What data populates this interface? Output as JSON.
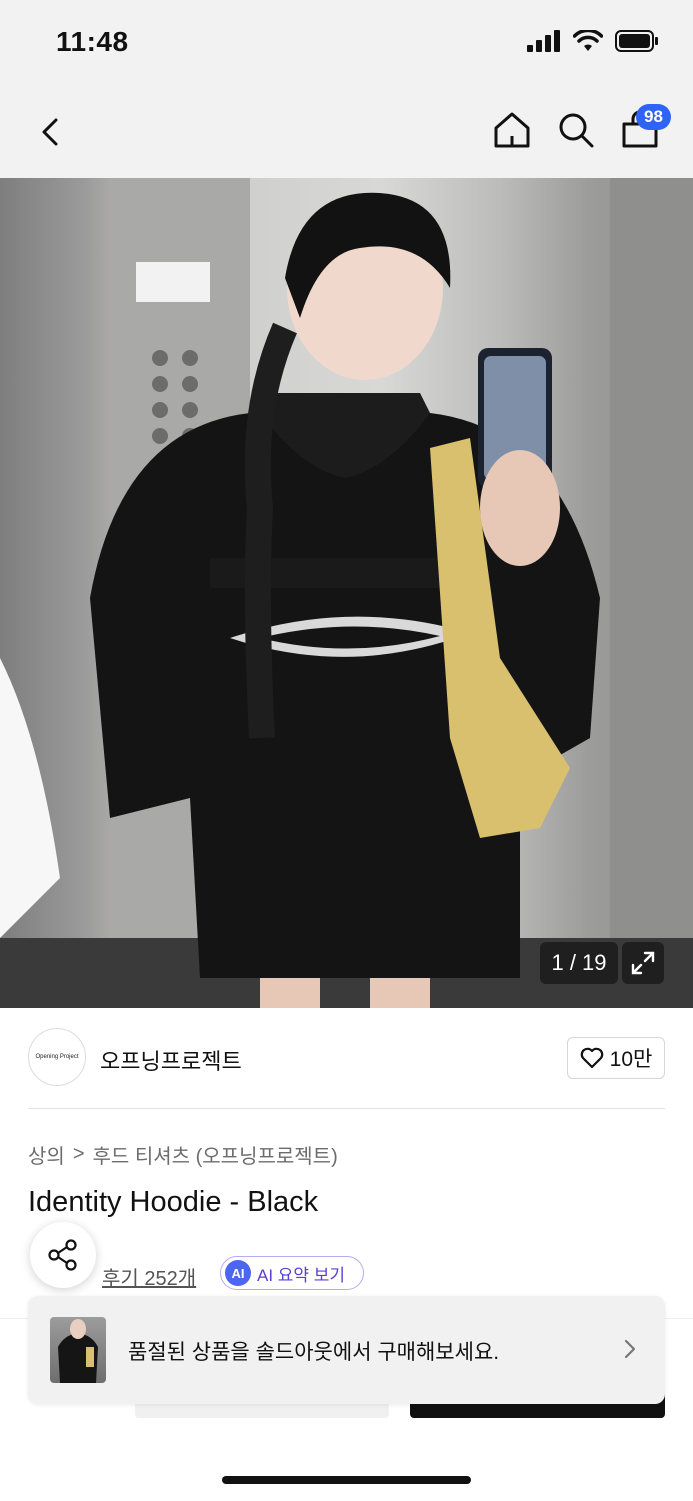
{
  "status_bar": {
    "time": "11:48"
  },
  "nav": {
    "cart_count": "98"
  },
  "gallery": {
    "counter": "1 / 19"
  },
  "brand": {
    "logo_text": "Opening Project",
    "name": "오프닝프로젝트",
    "likes": "10만"
  },
  "breadcrumb": {
    "category": "상의",
    "separator": ">",
    "subcategory": "후드 티셔츠 (오프닝프로젝트)"
  },
  "product": {
    "title": "Identity Hoodie - Black"
  },
  "reviews": {
    "label": "후기 252개",
    "ai_chip": "AI",
    "ai_summary": "AI 요약 보기"
  },
  "toast": {
    "message": "품절된 상품을 솔드아웃에서 구매해보세요."
  },
  "colors": {
    "accent": "#2d64f5",
    "ai_purple": "#5b3fd3"
  }
}
